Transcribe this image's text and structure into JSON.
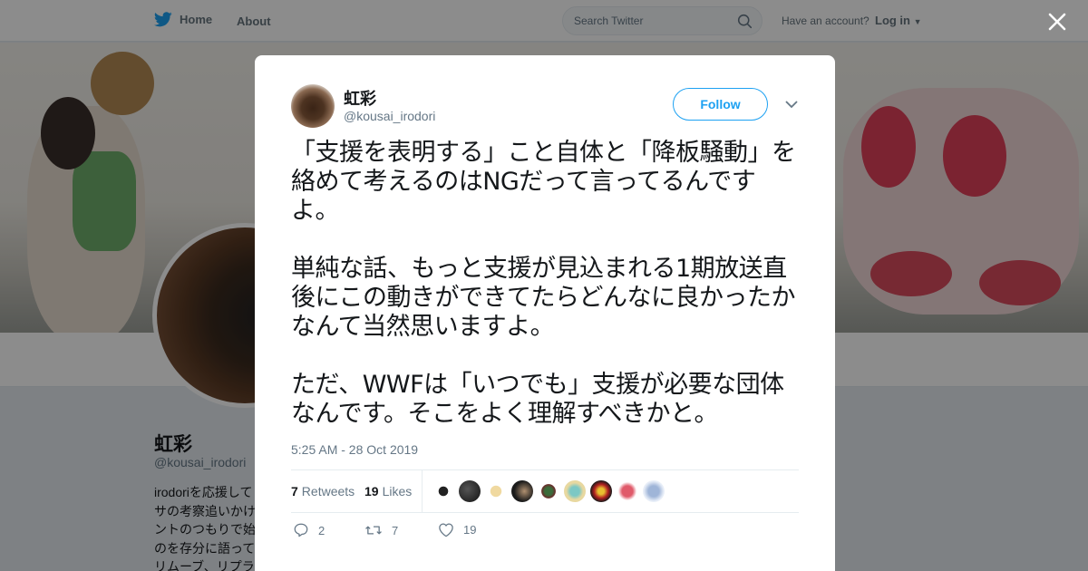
{
  "nav": {
    "home_label": "Home",
    "about_label": "About",
    "search_placeholder": "Search Twitter",
    "have_account": "Have an account?",
    "login_label": "Log in"
  },
  "profile": {
    "name": "虹彩",
    "handle": "@kousai_irodori",
    "bio_visible": "irodoriを応援して\nサの考察追いかけ\nントのつもりで始\nのを存分に語って\nリムーブ、リプラ"
  },
  "tweet": {
    "author_name": "虹彩",
    "author_handle": "@kousai_irodori",
    "follow_label": "Follow",
    "text": "「支援を表明する」こと自体と「降板騒動」を絡めて考えるのはNGだって言ってるんですよ。\n\n単純な話、もっと支援が見込まれる1期放送直後にこの動きができてたらどんなに良かったかなんて当然思いますよ。\n\nただ、WWFは「いつでも」支援が必要な団体なんです。そこをよく理解すべきかと。",
    "timestamp": "5:25 AM - 28 Oct 2019",
    "retweets_count": "7",
    "retweets_label": "Retweets",
    "likes_count": "19",
    "likes_label": "Likes",
    "reply_count": "2",
    "retweet_action_count": "7",
    "like_action_count": "19"
  },
  "icons": {
    "logo": "twitter-bird-icon",
    "search": "search-icon",
    "close": "close-icon",
    "caret": "chevron-down-icon",
    "reply": "reply-icon",
    "retweet": "retweet-icon",
    "like": "heart-icon"
  },
  "colors": {
    "accent": "#1da1f2",
    "text_primary": "#14171a",
    "text_secondary": "#657786"
  }
}
